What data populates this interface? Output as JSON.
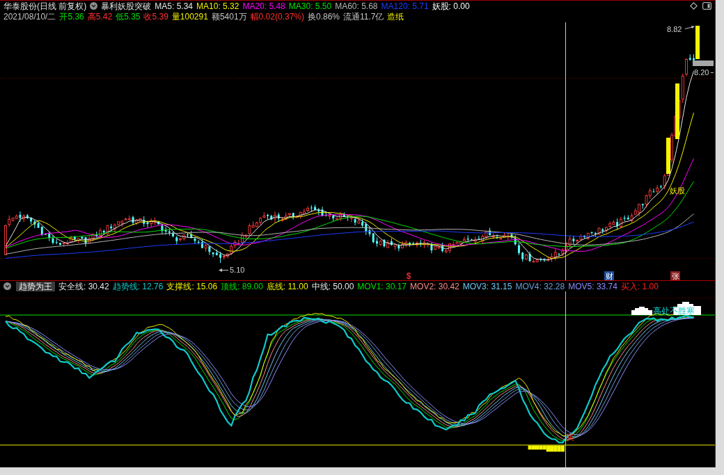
{
  "header": {
    "title": "华泰股份(日线 前复权)",
    "formula": "暴利妖股突破",
    "values": [
      {
        "text": "MA5: 5.34",
        "color": "#e6e6e6"
      },
      {
        "text": "MA10: 5.32",
        "color": "#f0f000"
      },
      {
        "text": "MA20: 5.48",
        "color": "#ff00ff"
      },
      {
        "text": "MA30: 5.50",
        "color": "#00e000"
      },
      {
        "text": "MA60: 5.68",
        "color": "#b4b4b4"
      },
      {
        "text": "MA120: 5.71",
        "color": "#1c3cff"
      },
      {
        "text": "妖股: 0.00",
        "color": "#fafafa"
      }
    ]
  },
  "quote": [
    {
      "text": "2021/08/10/二",
      "color": "#c4c4c4"
    },
    {
      "text": "开5.36",
      "color": "#00e000"
    },
    {
      "text": "高5.42",
      "color": "#ff3030"
    },
    {
      "text": "低5.35",
      "color": "#00e000"
    },
    {
      "text": "收5.39",
      "color": "#ff3030"
    },
    {
      "text": "量100291",
      "color": "#f0f000"
    },
    {
      "text": "额5401万",
      "color": "#c4c4c4"
    },
    {
      "text": "幅0.02(0.37%)",
      "color": "#ff3030"
    },
    {
      "text": "换0.86%",
      "color": "#c4c4c4"
    },
    {
      "text": "流通11.7亿",
      "color": "#c4c4c4"
    },
    {
      "text": "造纸",
      "color": "#f0f000"
    }
  ],
  "price_chart": {
    "high_label": "8.82",
    "last_label": "8.20",
    "low_label": "5.10",
    "signal_label": "妖股",
    "markers": [
      {
        "text": "$",
        "kind": "glyph",
        "color": "#e03030"
      },
      {
        "text": "财",
        "kind": "badge",
        "color": "#1f4f9a"
      },
      {
        "text": "张",
        "kind": "badge",
        "color": "#8a1c1c"
      }
    ]
  },
  "indicator": {
    "name": "趋势为王",
    "values": [
      {
        "text": "安全线: 30.42",
        "color": "#e6e6e6"
      },
      {
        "text": "趋势线: 12.76",
        "color": "#10c8c8"
      },
      {
        "text": "支撑线: 15.06",
        "color": "#f0f000"
      },
      {
        "text": "顶线: 89.00",
        "color": "#00e000"
      },
      {
        "text": "底线: 11.00",
        "color": "#f0f000"
      },
      {
        "text": "中线: 50.00",
        "color": "#e6e6e6"
      },
      {
        "text": "MOV1: 30.17",
        "color": "#00e000"
      },
      {
        "text": "MOV2: 30.42",
        "color": "#ff8a8a"
      },
      {
        "text": "MOV3: 31.15",
        "color": "#70c8f0"
      },
      {
        "text": "MOV4: 32.28",
        "color": "#6a9fd8"
      },
      {
        "text": "MOV5: 33.74",
        "color": "#8c8cff"
      },
      {
        "text": "买入: 1.00",
        "color": "#ff2020"
      }
    ],
    "buy_label": "买",
    "banner": "高处不胜寒"
  }
}
